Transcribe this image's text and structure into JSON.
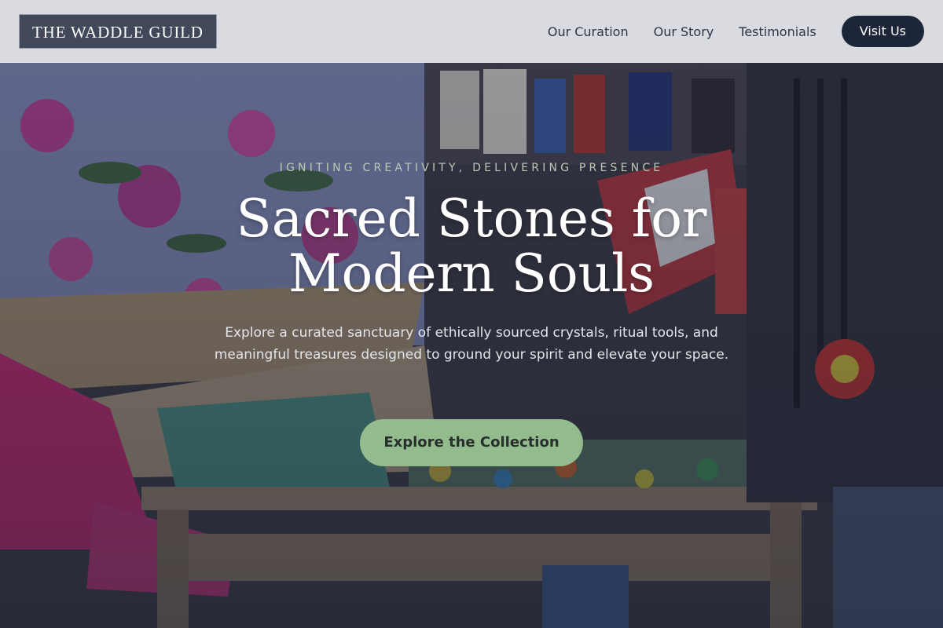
{
  "header": {
    "logo": "THE WADDLE GUILD",
    "nav": [
      "Our Curation",
      "Our Story",
      "Testimonials"
    ],
    "cta": "Visit Us"
  },
  "hero": {
    "kicker": "IGNITING CREATIVITY, DELIVERING PRESENCE",
    "title": "Sacred Stones for Modern Souls",
    "subtitle": "Explore a curated sanctuary of ethically sourced crystals, ritual tools, and meaningful treasures designed to ground your spirit and elevate your space.",
    "cta": "Explore the Collection",
    "background": "market-stall-photo"
  },
  "colors": {
    "logo_bg": "#414859",
    "visit_button": "#1d2638",
    "cta_button": "#93bb8d",
    "kicker": "#b9c9b4"
  }
}
